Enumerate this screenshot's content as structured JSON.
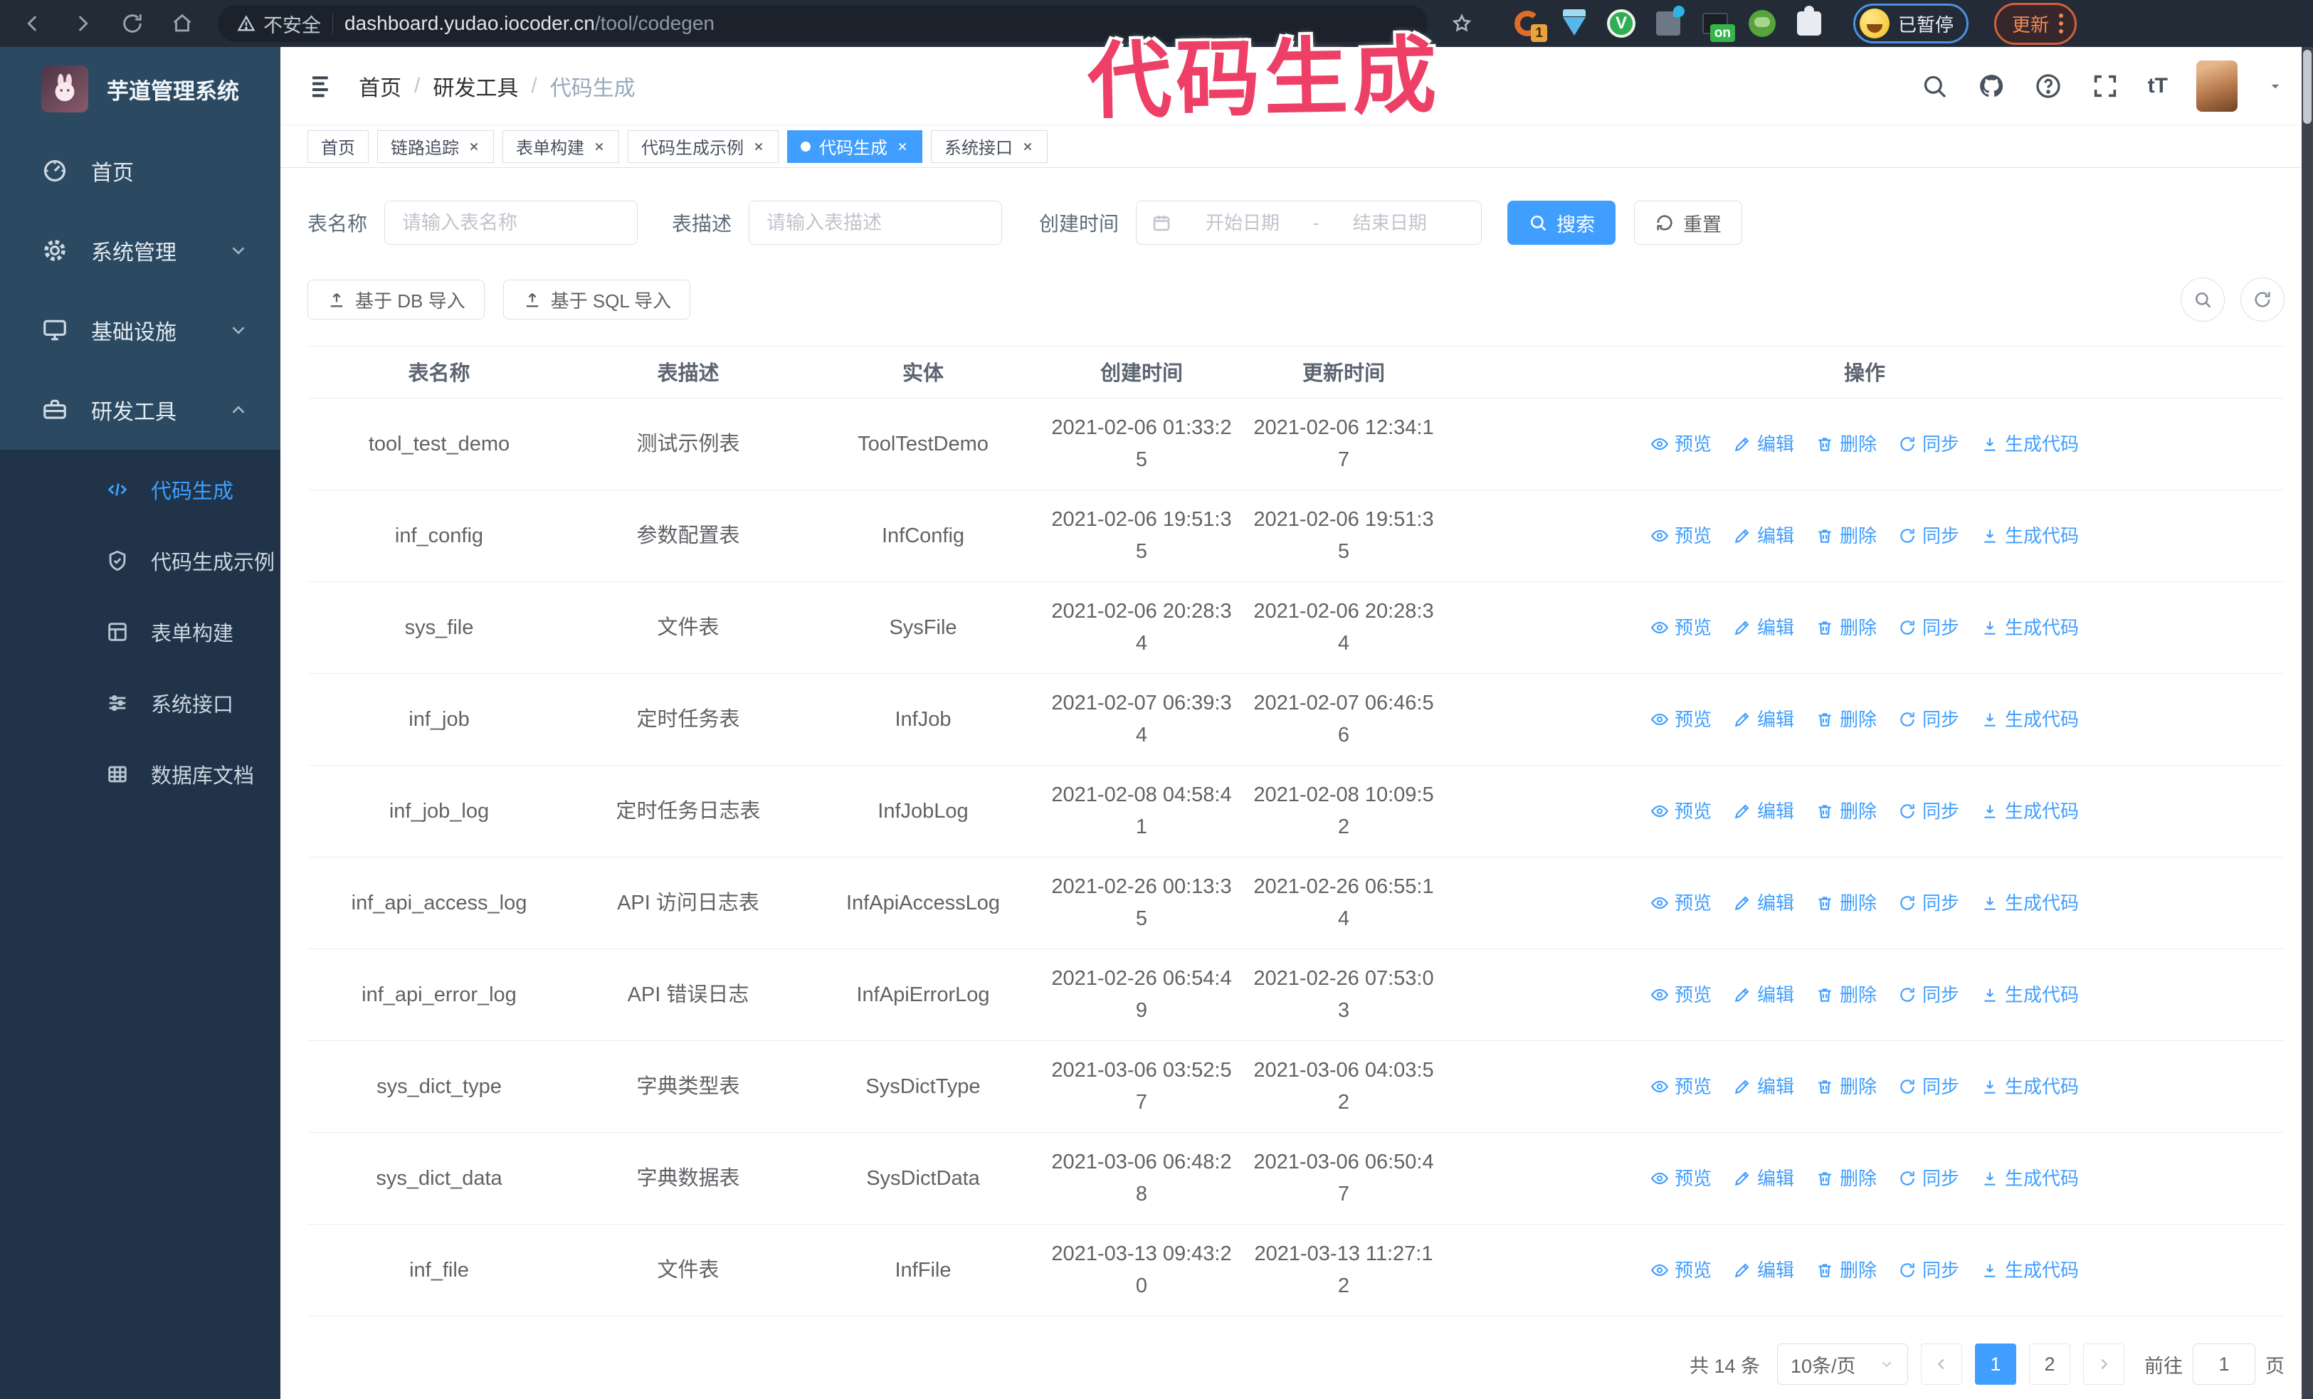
{
  "browser": {
    "security_label": "不安全",
    "url_host": "dashboard.yudao.iocoder.cn",
    "url_path": "/tool/codegen",
    "extension_badge": "1",
    "extension_on_badge": "on",
    "profile_status": "已暂停",
    "update_button": "更新"
  },
  "annotation": {
    "text": "代码生成",
    "color": "#ee4066"
  },
  "sidebar": {
    "app_title": "芋道管理系统",
    "items": [
      {
        "label": "首页",
        "icon": "dashboard-icon",
        "expandable": false,
        "state": "none"
      },
      {
        "label": "系统管理",
        "icon": "gear-icon",
        "expandable": true,
        "state": "collapsed"
      },
      {
        "label": "基础设施",
        "icon": "monitor-icon",
        "expandable": true,
        "state": "collapsed"
      },
      {
        "label": "研发工具",
        "icon": "toolbox-icon",
        "expandable": true,
        "state": "expanded"
      }
    ],
    "submenu": [
      {
        "label": "代码生成",
        "icon": "code-icon",
        "active": true
      },
      {
        "label": "代码生成示例",
        "icon": "shield-check-icon",
        "active": false
      },
      {
        "label": "表单构建",
        "icon": "form-icon",
        "active": false
      },
      {
        "label": "系统接口",
        "icon": "sliders-icon",
        "active": false
      },
      {
        "label": "数据库文档",
        "icon": "grid-icon",
        "active": false
      }
    ]
  },
  "header": {
    "breadcrumb": [
      "首页",
      "研发工具",
      "代码生成"
    ]
  },
  "tabs": [
    {
      "label": "首页",
      "closable": false,
      "active": false
    },
    {
      "label": "链路追踪",
      "closable": true,
      "active": false
    },
    {
      "label": "表单构建",
      "closable": true,
      "active": false
    },
    {
      "label": "代码生成示例",
      "closable": true,
      "active": false
    },
    {
      "label": "代码生成",
      "closable": true,
      "active": true
    },
    {
      "label": "系统接口",
      "closable": true,
      "active": false
    }
  ],
  "search_form": {
    "table_name_label": "表名称",
    "table_name_placeholder": "请输入表名称",
    "table_desc_label": "表描述",
    "table_desc_placeholder": "请输入表描述",
    "create_time_label": "创建时间",
    "date_start_placeholder": "开始日期",
    "date_separator": "-",
    "date_end_placeholder": "结束日期",
    "search_button": "搜索",
    "reset_button": "重置"
  },
  "toolbar": {
    "import_db_button": "基于 DB 导入",
    "import_sql_button": "基于 SQL 导入"
  },
  "table": {
    "columns": [
      "表名称",
      "表描述",
      "实体",
      "创建时间",
      "更新时间",
      "操作"
    ],
    "actions": [
      {
        "label": "预览",
        "icon": "eye-icon"
      },
      {
        "label": "编辑",
        "icon": "edit-icon"
      },
      {
        "label": "删除",
        "icon": "trash-icon"
      },
      {
        "label": "同步",
        "icon": "sync-icon"
      },
      {
        "label": "生成代码",
        "icon": "download-icon"
      }
    ],
    "rows": [
      {
        "name": "tool_test_demo",
        "desc": "测试示例表",
        "entity": "ToolTestDemo",
        "created": "2021-02-06 01:33:25",
        "updated": "2021-02-06 12:34:17"
      },
      {
        "name": "inf_config",
        "desc": "参数配置表",
        "entity": "InfConfig",
        "created": "2021-02-06 19:51:35",
        "updated": "2021-02-06 19:51:35"
      },
      {
        "name": "sys_file",
        "desc": "文件表",
        "entity": "SysFile",
        "created": "2021-02-06 20:28:34",
        "updated": "2021-02-06 20:28:34"
      },
      {
        "name": "inf_job",
        "desc": "定时任务表",
        "entity": "InfJob",
        "created": "2021-02-07 06:39:34",
        "updated": "2021-02-07 06:46:56"
      },
      {
        "name": "inf_job_log",
        "desc": "定时任务日志表",
        "entity": "InfJobLog",
        "created": "2021-02-08 04:58:41",
        "updated": "2021-02-08 10:09:52"
      },
      {
        "name": "inf_api_access_log",
        "desc": "API 访问日志表",
        "entity": "InfApiAccessLog",
        "created": "2021-02-26 00:13:35",
        "updated": "2021-02-26 06:55:14"
      },
      {
        "name": "inf_api_error_log",
        "desc": "API 错误日志",
        "entity": "InfApiErrorLog",
        "created": "2021-02-26 06:54:49",
        "updated": "2021-02-26 07:53:03"
      },
      {
        "name": "sys_dict_type",
        "desc": "字典类型表",
        "entity": "SysDictType",
        "created": "2021-03-06 03:52:57",
        "updated": "2021-03-06 04:03:52"
      },
      {
        "name": "sys_dict_data",
        "desc": "字典数据表",
        "entity": "SysDictData",
        "created": "2021-03-06 06:48:28",
        "updated": "2021-03-06 06:50:47"
      },
      {
        "name": "inf_file",
        "desc": "文件表",
        "entity": "InfFile",
        "created": "2021-03-13 09:43:20",
        "updated": "2021-03-13 11:27:12"
      }
    ]
  },
  "pagination": {
    "total_label": "共 14 条",
    "page_size": "10条/页",
    "pages": [
      "1",
      "2"
    ],
    "active_page": "1",
    "goto_label": "前往",
    "goto_value": "1",
    "goto_suffix": "页"
  },
  "colors": {
    "accent": "#409eff",
    "sidebar_bg": "#2b4a61",
    "submenu_bg": "#203349",
    "chrome_bg": "#232b36",
    "annotation_pink": "#ee4066"
  }
}
